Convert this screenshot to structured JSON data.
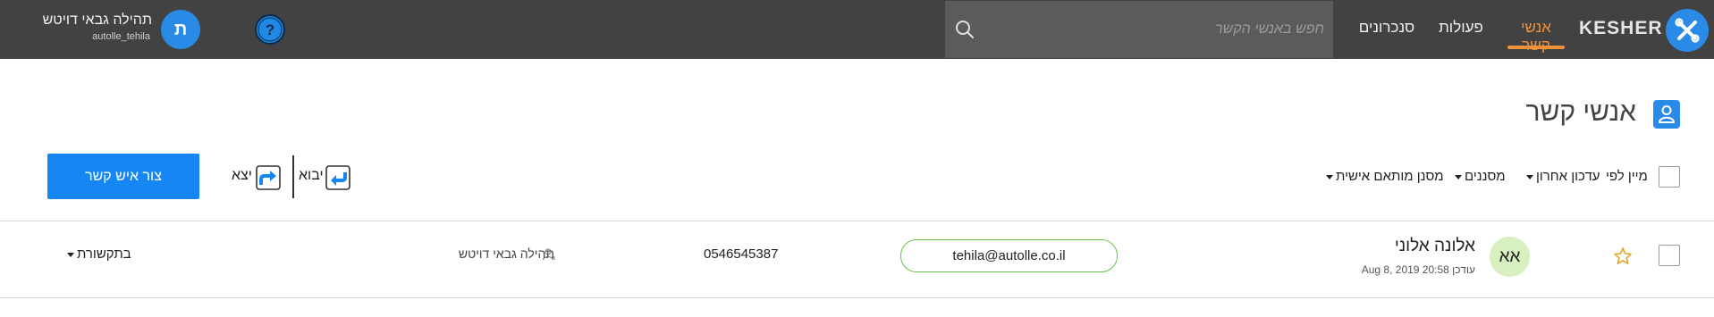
{
  "app": {
    "logo_text": "KESHER"
  },
  "nav": {
    "items": [
      {
        "label": "אנשי קשר",
        "active": true
      },
      {
        "label": "פעולות",
        "active": false
      },
      {
        "label": "סנכרונים",
        "active": false
      }
    ]
  },
  "search": {
    "placeholder": "חפש באנשי הקשר",
    "value": ""
  },
  "user": {
    "initial": "ת",
    "name": "תהילה גבאי דויטש",
    "login": "autolle_tehila"
  },
  "page": {
    "title": "אנשי קשר"
  },
  "toolbar": {
    "sort_label": "מיין לפי",
    "sort_value": "עדכון אחרון",
    "filters_label": "מסננים",
    "custom_filter_label": "מסנן מותאם אישית",
    "import_label": "יבוא",
    "export_label": "יצא",
    "create_label": "צור איש קשר"
  },
  "contacts": [
    {
      "initials": "אא",
      "name": "אלונה אלוני",
      "updated": "עודכן Aug 8, 2019 20:58",
      "email": "tehila@autolle.co.il",
      "phone": "0546545387",
      "owner": "תהילה גבאי דויטש",
      "status": "בתקשורת"
    }
  ],
  "colors": {
    "topbar": "#424242",
    "accent": "#f0913a",
    "brand": "#2a8be6",
    "button": "#1687f2",
    "email_border": "#6cc24a",
    "avatar_bg": "#d8efbf"
  }
}
